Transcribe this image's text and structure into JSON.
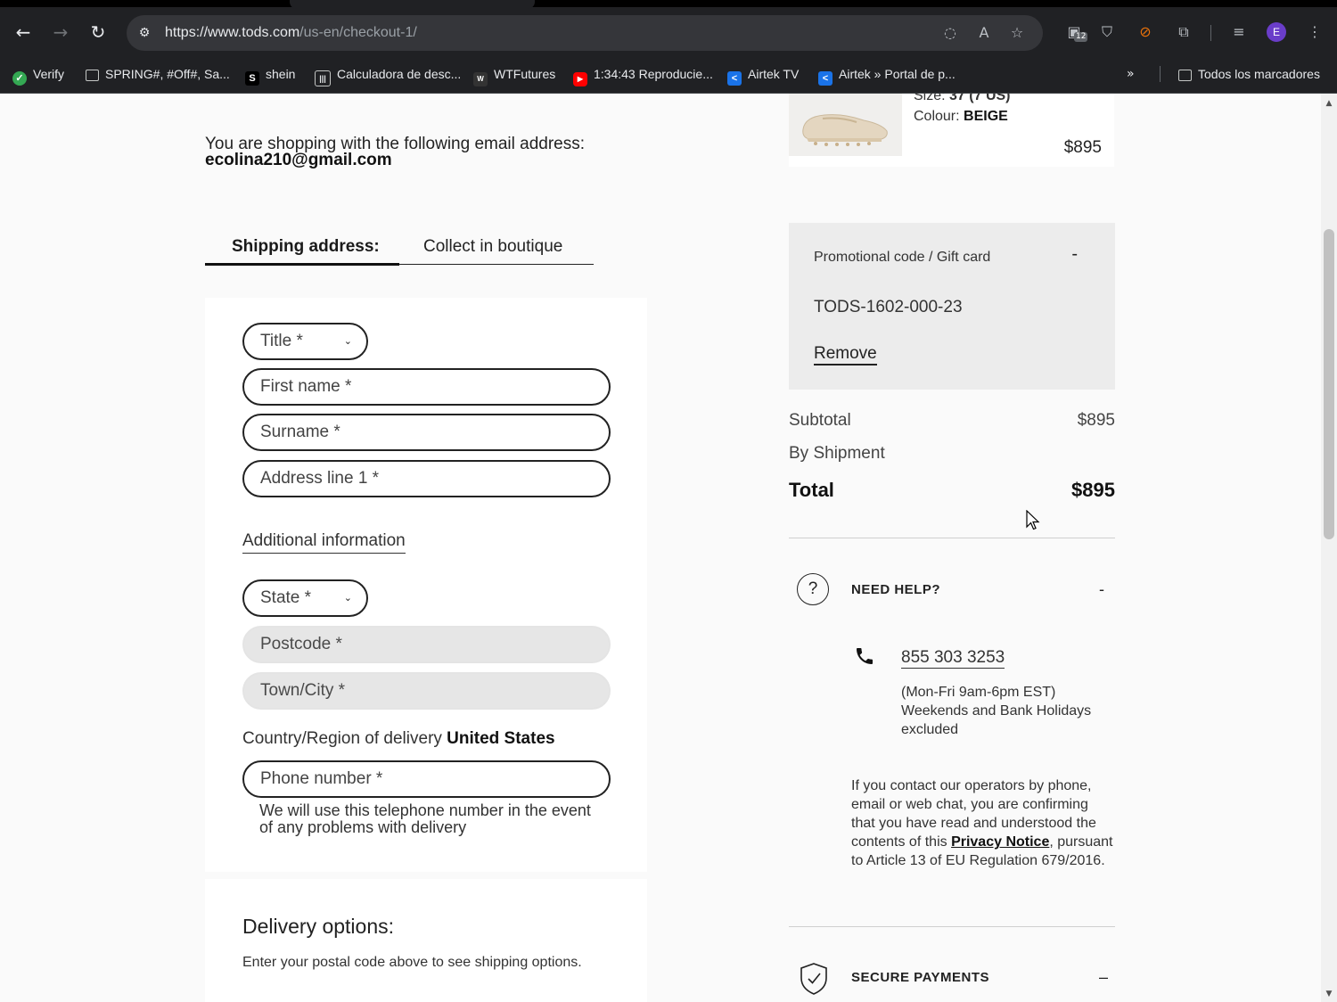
{
  "browser": {
    "url_host": "https://www.tods.com",
    "url_path": "/us-en/checkout-1/",
    "profile_initial": "E",
    "extension_badge": "12",
    "bookmarks": [
      {
        "label": "Verify",
        "icon": "verify-icon"
      },
      {
        "label": "SPRING#, #Off#, Sa...",
        "icon": "folder-icon"
      },
      {
        "label": "shein",
        "icon": "shein-icon"
      },
      {
        "label": "Calculadora de desc...",
        "icon": "calculator-icon"
      },
      {
        "label": "WTFutures",
        "icon": "wtfutures-icon"
      },
      {
        "label": "1:34:43 Reproducie...",
        "icon": "youtube-icon"
      },
      {
        "label": "Airtek TV",
        "icon": "airtek-icon"
      },
      {
        "label": "Airtek » Portal de p...",
        "icon": "airtek-icon"
      }
    ],
    "all_bookmarks_label": "Todos los marcadores"
  },
  "checkout": {
    "email_intro": "You are shopping with the following email address:",
    "email": "ecolina210@gmail.com",
    "tabs": [
      "Shipping address:",
      "Collect in boutique"
    ],
    "fields": {
      "title": "Title *",
      "first_name": "First name *",
      "surname": "Surname *",
      "address1": "Address line 1 *",
      "additional_info": "Additional information",
      "state": "State *",
      "postcode": "Postcode *",
      "town": "Town/City *",
      "country_label": "Country/Region of delivery",
      "country_value": "United States",
      "phone": "Phone number *",
      "phone_note": "We will use this telephone number in the event of any problems with delivery"
    },
    "delivery": {
      "title": "Delivery options:",
      "note": "Enter your postal code above to see shipping options."
    }
  },
  "summary": {
    "product": {
      "size_label": "Size:",
      "size_value": "37 (7 US)",
      "colour_label": "Colour:",
      "colour_value": "BEIGE",
      "price": "$895"
    },
    "promo": {
      "title": "Promotional code / Gift card",
      "toggle": "-",
      "code": "TODS-1602-000-23",
      "remove": "Remove"
    },
    "subtotal_label": "Subtotal",
    "subtotal_value": "$895",
    "shipment_label": "By Shipment",
    "total_label": "Total",
    "total_value": "$895"
  },
  "help": {
    "title": "NEED HELP?",
    "toggle": "-",
    "phone": "855 303 3253",
    "hours": "(Mon-Fri 9am-6pm EST) Weekends and Bank Holidays excluded",
    "privacy_before": "If you contact our operators by phone, email or web chat, you are confirming that you have read and understood the contents of this ",
    "privacy_link": "Privacy Notice",
    "privacy_after": ", pursuant to Article 13 of EU Regulation 679/2016.",
    "secure_title": "SECURE PAYMENTS",
    "secure_toggle": "–"
  }
}
